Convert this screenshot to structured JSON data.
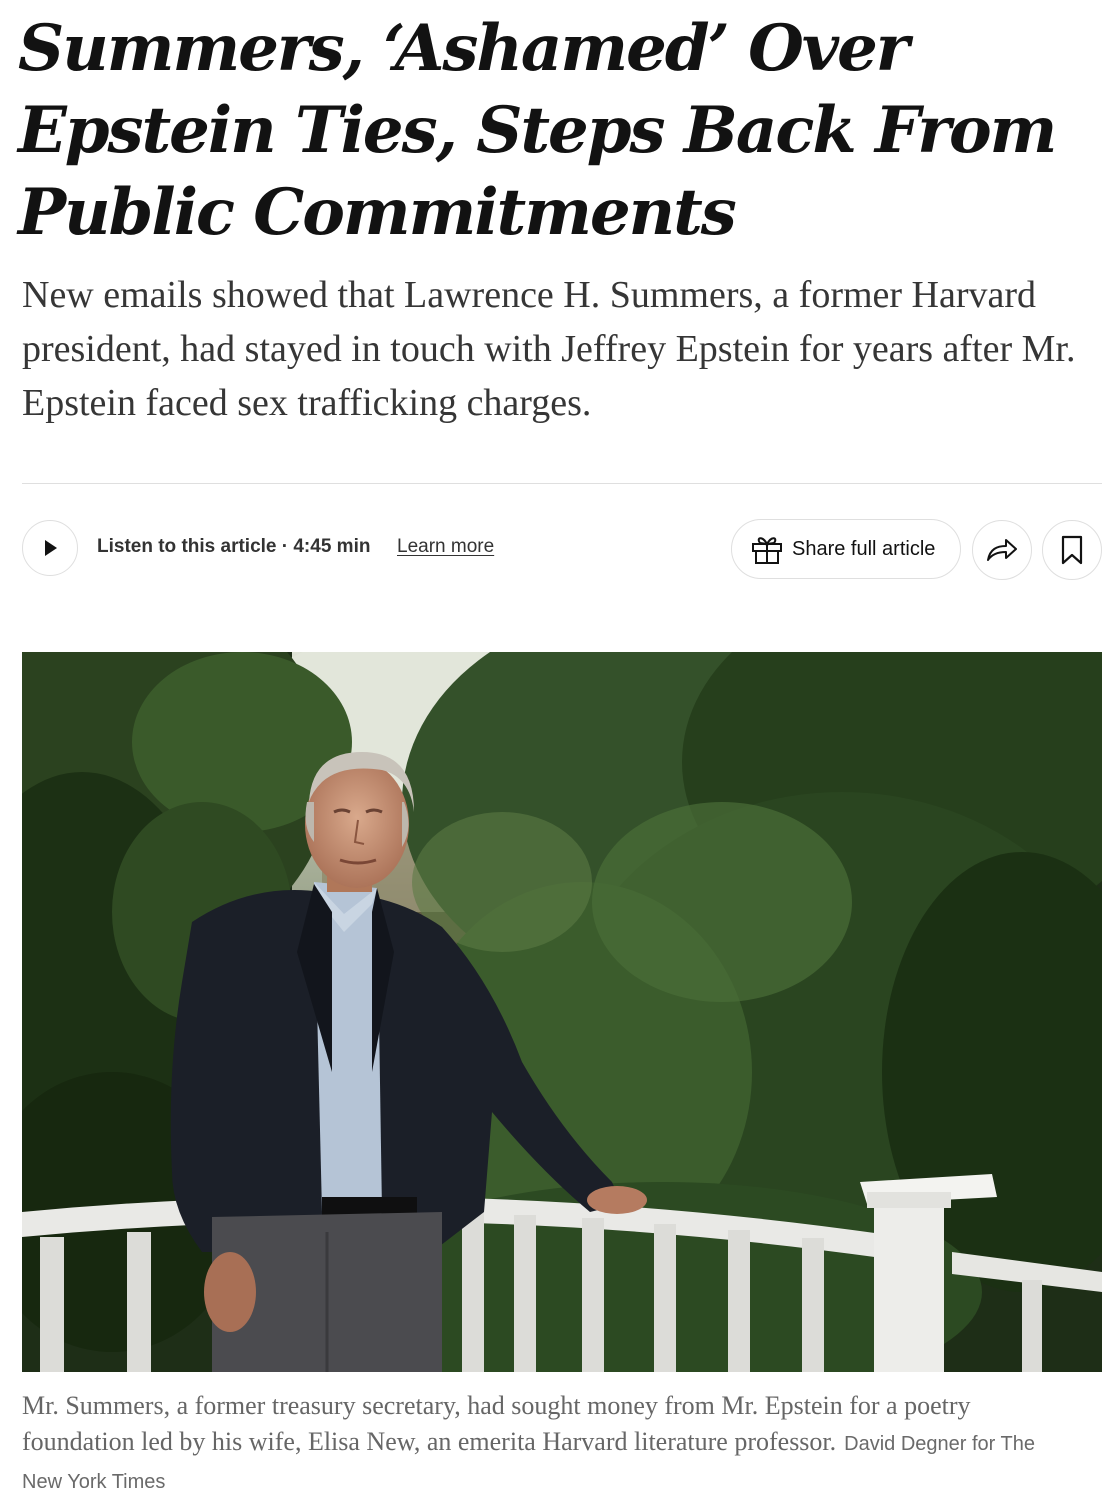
{
  "article": {
    "headline": "Summers, ‘Ashamed’ Over Epstein Ties, Steps Back From Public Commitments",
    "summary": "New emails showed that Lawrence H. Summers, a former Harvard president, had stayed in touch with Jeffrey Epstein for years after Mr. Epstein faced sex trafficking charges."
  },
  "toolbar": {
    "listen_text": "Listen to this article · 4:45 min",
    "learn_more": "Learn more",
    "share_label": "Share full article",
    "icons": {
      "play": "play-icon",
      "gift": "gift-icon",
      "share": "share-arrow-icon",
      "bookmark": "bookmark-icon"
    }
  },
  "image": {
    "caption": "Mr. Summers, a former treasury secretary, had sought money from Mr. Epstein for a poetry foundation led by his wife, Elisa New, an emerita Harvard literature professor.",
    "credit": "David Degner for The New York Times"
  }
}
